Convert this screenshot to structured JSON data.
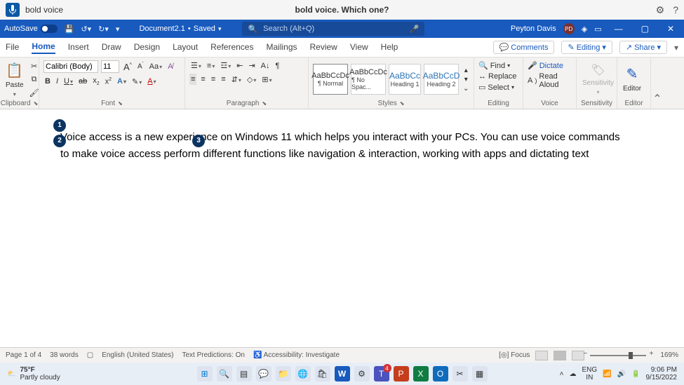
{
  "voice": {
    "command": "bold voice",
    "prompt": "bold voice. Which one?"
  },
  "titlebar": {
    "autosave_label": "AutoSave",
    "doc_name": "Document2.1",
    "save_status": "Saved",
    "search_placeholder": "Search (Alt+Q)",
    "user_name": "Peyton Davis",
    "user_initials": "PD"
  },
  "tabs": {
    "file": "File",
    "home": "Home",
    "insert": "Insert",
    "draw": "Draw",
    "design": "Design",
    "layout": "Layout",
    "references": "References",
    "mailings": "Mailings",
    "review": "Review",
    "view": "View",
    "help": "Help",
    "comments": "Comments",
    "editing": "Editing",
    "share": "Share"
  },
  "ribbon": {
    "clipboard": {
      "paste": "Paste",
      "label": "Clipboard"
    },
    "font": {
      "name": "Calibri (Body)",
      "size": "11",
      "grow": "A",
      "shrink": "A",
      "case": "Aa",
      "clear": "A",
      "bold": "B",
      "italic": "I",
      "underline": "U",
      "strike": "ab",
      "sub": "x",
      "sup": "x",
      "effects": "A",
      "highlight": "A",
      "color": "A",
      "label": "Font"
    },
    "paragraph": {
      "label": "Paragraph"
    },
    "styles": {
      "items": [
        {
          "sample": "AaBbCcDc",
          "name": "¶ Normal"
        },
        {
          "sample": "AaBbCcDc",
          "name": "¶ No Spac..."
        },
        {
          "sample": "AaBbCc",
          "name": "Heading 1"
        },
        {
          "sample": "AaBbCcD",
          "name": "Heading 2"
        }
      ],
      "label": "Styles"
    },
    "editing": {
      "find": "Find",
      "replace": "Replace",
      "select": "Select",
      "label": "Editing"
    },
    "voice_group": {
      "dictate": "Dictate",
      "read_aloud": "Read Aloud",
      "label": "Voice"
    },
    "sensitivity": {
      "button": "Sensitivity",
      "label": "Sensitivity"
    },
    "editor": {
      "button": "Editor",
      "label": "Editor"
    }
  },
  "doc": {
    "badges": [
      "1",
      "2",
      "3"
    ],
    "text": "Voice access is a new experience on Windows 11 which helps you interact with your PCs. You can use voice commands to make voice access perform different functions like navigation & interaction, working with apps and dictating text"
  },
  "status": {
    "page": "Page 1 of 4",
    "words": "38 words",
    "lang": "English (United States)",
    "pred": "Text Predictions: On",
    "acc": "Accessibility: Investigate",
    "focus": "Focus",
    "zoom": "169%"
  },
  "taskbar": {
    "temp": "75°F",
    "weather": "Partly cloudy",
    "lang_code": "ENG",
    "lang_region": "IN",
    "time": "9:06 PM",
    "date": "9/15/2022",
    "teams_badge": "4"
  }
}
